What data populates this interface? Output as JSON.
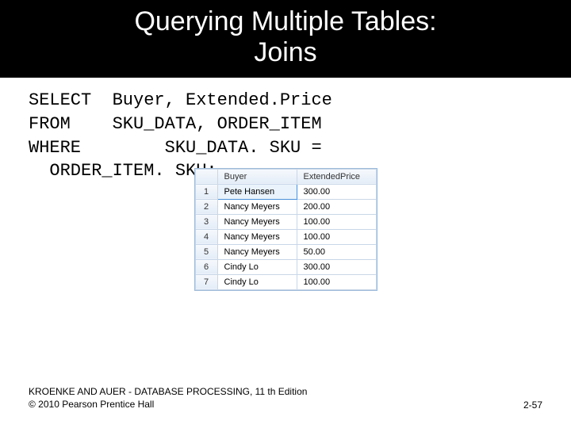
{
  "title": {
    "line1": "Querying Multiple Tables:",
    "line2": "Joins"
  },
  "sql": {
    "select": {
      "kw": "SELECT",
      "rest": "Buyer, Extended.Price"
    },
    "from": {
      "kw": "FROM",
      "rest": "SKU_DATA, ORDER_ITEM"
    },
    "where": {
      "kw": "WHERE",
      "rest": "SKU_DATA. SKU ="
    },
    "where2": "ORDER_ITEM. SKU;"
  },
  "chart_data": {
    "type": "table",
    "columns": [
      "",
      "Buyer",
      "ExtendedPrice"
    ],
    "rows": [
      {
        "n": "1",
        "buyer": "Pete Hansen",
        "price": "300.00"
      },
      {
        "n": "2",
        "buyer": "Nancy Meyers",
        "price": "200.00"
      },
      {
        "n": "3",
        "buyer": "Nancy Meyers",
        "price": "100.00"
      },
      {
        "n": "4",
        "buyer": "Nancy Meyers",
        "price": "100.00"
      },
      {
        "n": "5",
        "buyer": "Nancy Meyers",
        "price": "50.00"
      },
      {
        "n": "6",
        "buyer": "Cindy Lo",
        "price": "300.00"
      },
      {
        "n": "7",
        "buyer": "Cindy Lo",
        "price": "100.00"
      }
    ]
  },
  "footer": {
    "line1": "KROENKE AND AUER - DATABASE PROCESSING, 11 th Edition",
    "line2": "© 2010 Pearson Prentice Hall",
    "page": "2-57"
  }
}
